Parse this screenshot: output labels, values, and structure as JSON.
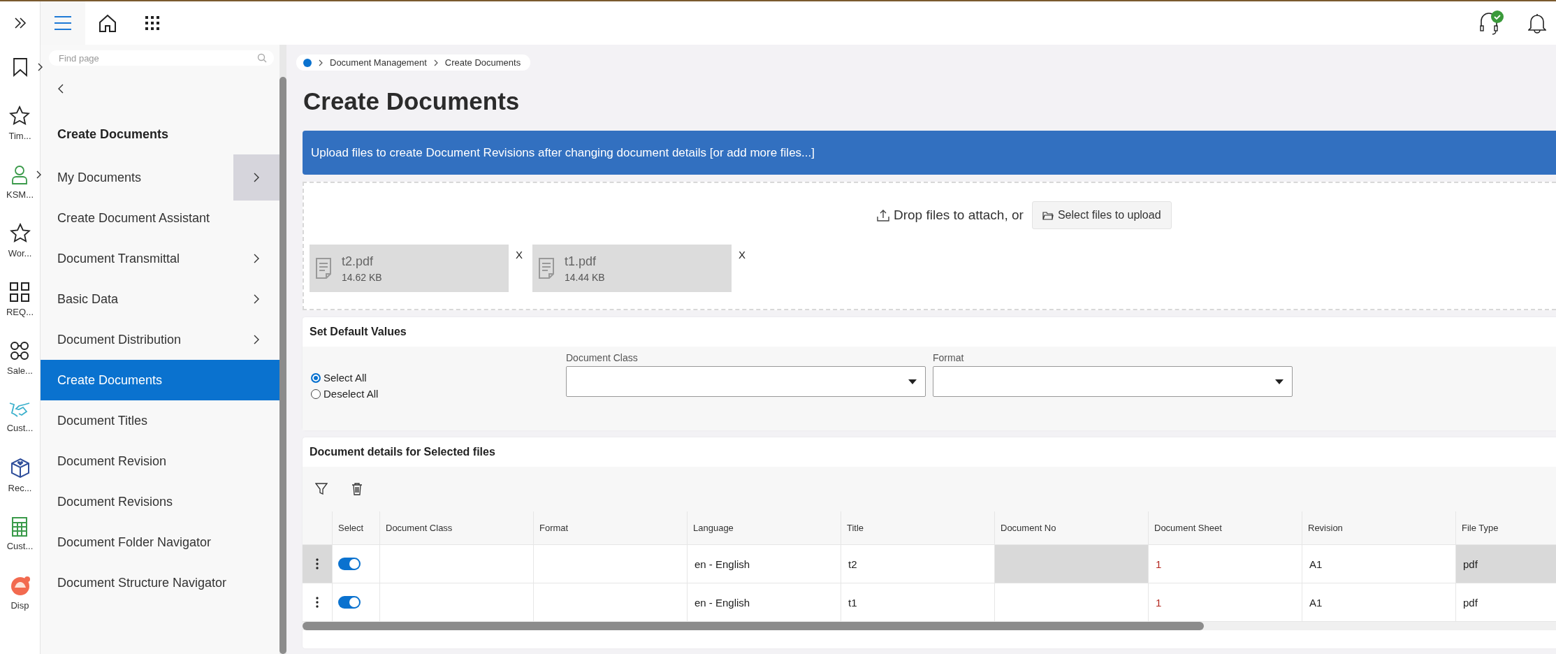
{
  "rail": {
    "items": [
      {
        "kind": "bookmark",
        "expandable": true
      },
      {
        "kind": "star",
        "label": "Tim...",
        "expandable": false
      },
      {
        "kind": "person",
        "label": "KSM...",
        "expandable": true
      },
      {
        "kind": "star",
        "label": "Wor...",
        "expandable": false
      },
      {
        "kind": "grid",
        "label": "REQ...",
        "expandable": false
      },
      {
        "kind": "rings",
        "label": "Sale...",
        "expandable": false
      },
      {
        "kind": "handshake",
        "label": "Cust...",
        "expandable": false
      },
      {
        "kind": "cube",
        "label": "Rec...",
        "expandable": false
      },
      {
        "kind": "calculator",
        "label": "Cust...",
        "expandable": false
      },
      {
        "kind": "face",
        "label": "Disp",
        "expandable": false
      }
    ]
  },
  "top_bar": {
    "nav": [
      {
        "kind": "menu",
        "selected": true
      },
      {
        "kind": "home",
        "selected": false
      },
      {
        "kind": "apps",
        "selected": false
      }
    ]
  },
  "sidebar": {
    "search": {
      "placeholder": "Find page"
    },
    "heading": "Create Documents",
    "items": [
      {
        "label": "My Documents",
        "has_submenu": true,
        "hovered": true,
        "selected": false
      },
      {
        "label": "Create Document Assistant",
        "has_submenu": false,
        "selected": false
      },
      {
        "label": "Document Transmittal",
        "has_submenu": true,
        "hovered": false,
        "selected": false
      },
      {
        "label": "Basic Data",
        "has_submenu": true,
        "hovered": false,
        "selected": false
      },
      {
        "label": "Document Distribution",
        "has_submenu": true,
        "hovered": false,
        "selected": false
      },
      {
        "label": "Create Documents",
        "has_submenu": false,
        "selected": true
      },
      {
        "label": "Document Titles",
        "has_submenu": false,
        "selected": false
      },
      {
        "label": "Document Revision",
        "has_submenu": false,
        "selected": false
      },
      {
        "label": "Document Revisions",
        "has_submenu": false,
        "selected": false
      },
      {
        "label": "Document Folder Navigator",
        "has_submenu": false,
        "selected": false
      },
      {
        "label": "Document Structure Navigator",
        "has_submenu": false,
        "selected": false
      }
    ]
  },
  "breadcrumb": [
    "Document Management",
    "Create Documents"
  ],
  "page_title": "Create Documents",
  "banner": "Upload files to create Document Revisions after changing document details [or add more files...]",
  "dropzone": {
    "prompt": "Drop files to attach, or",
    "button": "Select files to upload",
    "files": [
      {
        "name": "t2.pdf",
        "size": "14.62 KB",
        "remove": "X"
      },
      {
        "name": "t1.pdf",
        "size": "14.44 KB",
        "remove": "X"
      }
    ]
  },
  "defaults": {
    "title": "Set Default Values",
    "options": [
      {
        "label": "Select All",
        "selected": true
      },
      {
        "label": "Deselect All",
        "selected": false
      }
    ],
    "fields": [
      {
        "label": "Document Class"
      },
      {
        "label": "Format"
      }
    ]
  },
  "details": {
    "title": "Document details for Selected files",
    "table": {
      "columns": [
        "Select",
        "Document Class",
        "Format",
        "Language",
        "Title",
        "Document No",
        "Document Sheet",
        "Revision",
        "File Type"
      ],
      "rows": [
        {
          "selected": true,
          "select": true,
          "language": "en - English",
          "title": "t2",
          "document_sheet": "1",
          "revision": "A1",
          "file_type": "pdf"
        },
        {
          "selected": false,
          "select": true,
          "language": "en - English",
          "title": "t1",
          "document_sheet": "1",
          "revision": "A1",
          "file_type": "pdf"
        }
      ]
    }
  }
}
